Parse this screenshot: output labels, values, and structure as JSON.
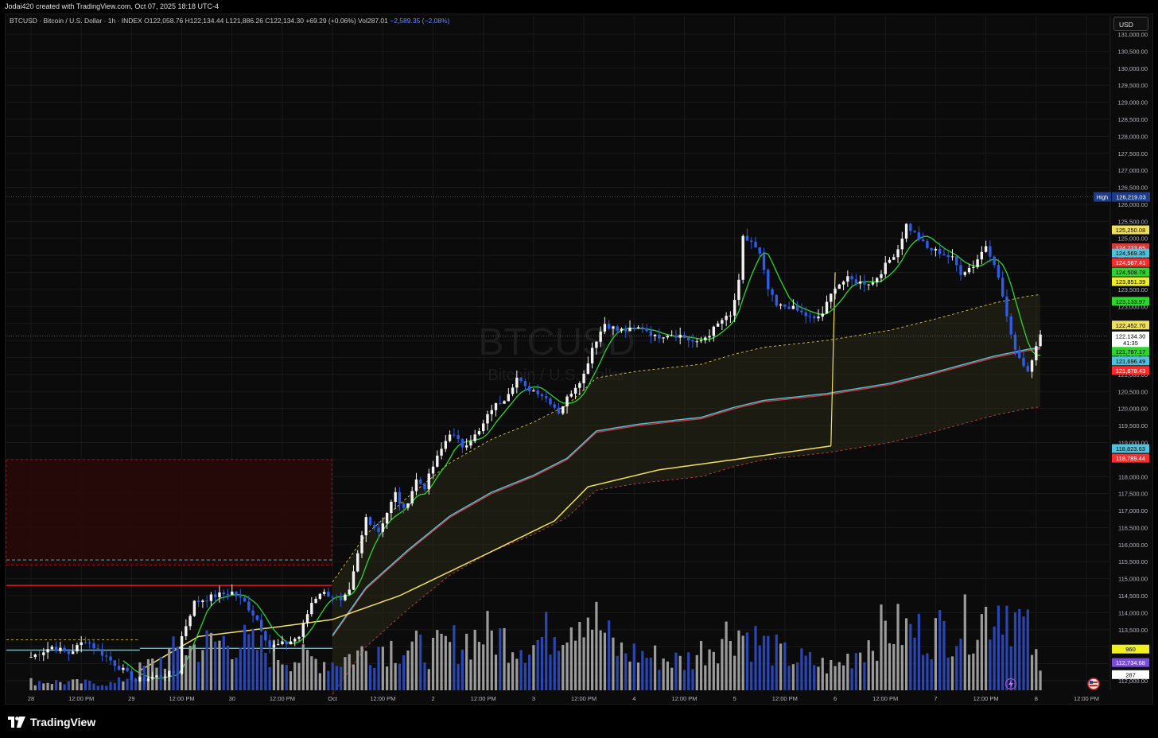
{
  "header": {
    "caption": "Jodai420 created with TradingView.com, Oct 07, 2025 18:18 UTC-4"
  },
  "legend": {
    "symbol": "BTCUSD · Bitcoin / U.S. Dollar · 1h · INDEX",
    "ohlc": "O122,058.76 H122,134.44 L121,886.26 C122,134.30 +69.29 (+0.06%)",
    "vol": "Vol287.01",
    "change": "−2,589.35 (−2.08%)"
  },
  "currency_label": "USD",
  "watermark": {
    "symbol": "BTCUSD",
    "name": "Bitcoin / U.S. Dollar"
  },
  "footer": {
    "brand": "TradingView"
  },
  "colors": {
    "background": "#0b0b0b",
    "grid": "#1a1a1a",
    "up_candle": "#f2f2f2",
    "down_candle": "#2f5ce6",
    "vwap_cyan": "#4fc3dd",
    "band_red": "#d23c3c",
    "band_yellow": "#f0e060",
    "green_line": "#2ed52e",
    "volume_up": "#9b9b9b",
    "volume_down": "#2a46b4"
  },
  "chart_data": {
    "type": "candlestick",
    "symbol": "BTCUSD",
    "timeframe": "1h",
    "y_ticks": [
      112000,
      112500,
      113000,
      113500,
      114000,
      114500,
      115000,
      115500,
      116000,
      116500,
      117000,
      117500,
      118000,
      118500,
      119000,
      119500,
      120000,
      120500,
      121000,
      121500,
      122000,
      122500,
      123000,
      123500,
      124000,
      124500,
      125000,
      125500,
      126000,
      126500,
      127000,
      127500,
      128000,
      128500,
      129000,
      129500,
      130000,
      130500,
      131000
    ],
    "y_tick_labels": [
      "112,000.00",
      "112,500.00",
      "113,000.00",
      "113,500.00",
      "114,000.00",
      "114,500.00",
      "115,000.00",
      "115,500.00",
      "116,000.00",
      "116,500.00",
      "117,000.00",
      "117,500.00",
      "118,000.00",
      "118,500.00",
      "119,000.00",
      "119,500.00",
      "120,000.00",
      "120,500.00",
      "121,000.00",
      "121,500.00",
      "122,000.00",
      "122,500.00",
      "123,000.00",
      "123,500.00",
      "124,000.00",
      "124,500.00",
      "125,000.00",
      "125,500.00",
      "126,000.00",
      "126,500.00",
      "127,000.00",
      "127,500.00",
      "128,000.00",
      "128,500.00",
      "129,000.00",
      "129,500.00",
      "130,000.00",
      "130,500.00",
      "131,000.00"
    ],
    "ylim": [
      111800,
      131300
    ],
    "x_ticks": [
      {
        "label": "28",
        "t": 0
      },
      {
        "label": "12:00 PM",
        "t": 12
      },
      {
        "label": "29",
        "t": 24
      },
      {
        "label": "12:00 PM",
        "t": 36
      },
      {
        "label": "30",
        "t": 48
      },
      {
        "label": "12:00 PM",
        "t": 60
      },
      {
        "label": "Oct",
        "t": 72
      },
      {
        "label": "12:00 PM",
        "t": 84
      },
      {
        "label": "2",
        "t": 96
      },
      {
        "label": "12:00 PM",
        "t": 108
      },
      {
        "label": "3",
        "t": 120
      },
      {
        "label": "12:00 PM",
        "t": 132
      },
      {
        "label": "4",
        "t": 144
      },
      {
        "label": "12:00 PM",
        "t": 156
      },
      {
        "label": "5",
        "t": 168
      },
      {
        "label": "12:00 PM",
        "t": 180
      },
      {
        "label": "6",
        "t": 192
      },
      {
        "label": "12:00 PM",
        "t": 204
      },
      {
        "label": "7",
        "t": 216
      },
      {
        "label": "12:00 PM",
        "t": 228
      },
      {
        "label": "8",
        "t": 240
      },
      {
        "label": "12:00 PM",
        "t": 252
      }
    ],
    "price_keypoints": [
      [
        0,
        112700
      ],
      [
        5,
        113000
      ],
      [
        9,
        112800
      ],
      [
        13,
        113200
      ],
      [
        19,
        112600
      ],
      [
        22,
        112300
      ],
      [
        25,
        112000
      ],
      [
        31,
        112150
      ],
      [
        35,
        112250
      ],
      [
        36,
        113300
      ],
      [
        39,
        114300
      ],
      [
        44,
        114500
      ],
      [
        48,
        114600
      ],
      [
        51,
        114300
      ],
      [
        54,
        113800
      ],
      [
        57,
        113000
      ],
      [
        61,
        113100
      ],
      [
        64,
        113300
      ],
      [
        67,
        114300
      ],
      [
        69,
        114600
      ],
      [
        72,
        114500
      ],
      [
        74,
        114300
      ],
      [
        76,
        114600
      ],
      [
        80,
        116800
      ],
      [
        83,
        116400
      ],
      [
        87,
        117500
      ],
      [
        89,
        117000
      ],
      [
        92,
        117900
      ],
      [
        94,
        117700
      ],
      [
        96,
        118300
      ],
      [
        100,
        119300
      ],
      [
        103,
        118900
      ],
      [
        107,
        119300
      ],
      [
        110,
        120000
      ],
      [
        113,
        120300
      ],
      [
        116,
        120900
      ],
      [
        118,
        120600
      ],
      [
        121,
        120500
      ],
      [
        124,
        120200
      ],
      [
        126,
        119900
      ],
      [
        129,
        120500
      ],
      [
        132,
        121000
      ],
      [
        134,
        121800
      ],
      [
        137,
        122500
      ],
      [
        140,
        122300
      ],
      [
        143,
        122300
      ],
      [
        146,
        122400
      ],
      [
        149,
        122100
      ],
      [
        152,
        122200
      ],
      [
        155,
        122150
      ],
      [
        159,
        121900
      ],
      [
        162,
        122200
      ],
      [
        165,
        122600
      ],
      [
        167,
        122700
      ],
      [
        169,
        123700
      ],
      [
        170,
        125000
      ],
      [
        172,
        124900
      ],
      [
        174,
        124500
      ],
      [
        176,
        123500
      ],
      [
        178,
        123000
      ],
      [
        181,
        123000
      ],
      [
        184,
        122800
      ],
      [
        187,
        122600
      ],
      [
        189,
        122800
      ],
      [
        192,
        123600
      ],
      [
        195,
        123800
      ],
      [
        198,
        123700
      ],
      [
        201,
        123700
      ],
      [
        204,
        124200
      ],
      [
        207,
        124700
      ],
      [
        209,
        125400
      ],
      [
        212,
        125000
      ],
      [
        214,
        124700
      ],
      [
        217,
        124600
      ],
      [
        220,
        124400
      ],
      [
        222,
        124000
      ],
      [
        225,
        124200
      ],
      [
        228,
        124800
      ],
      [
        230,
        124300
      ],
      [
        232,
        123300
      ],
      [
        234,
        122100
      ],
      [
        236,
        121500
      ],
      [
        238,
        121100
      ],
      [
        239,
        121500
      ],
      [
        240,
        121900
      ],
      [
        241,
        122134
      ]
    ],
    "volume_keypoints": [
      [
        0,
        0.08
      ],
      [
        20,
        0.06
      ],
      [
        35,
        0.35
      ],
      [
        48,
        0.45
      ],
      [
        60,
        0.3
      ],
      [
        72,
        0.25
      ],
      [
        84,
        0.4
      ],
      [
        96,
        0.35
      ],
      [
        108,
        0.5
      ],
      [
        120,
        0.4
      ],
      [
        132,
        0.75
      ],
      [
        140,
        0.35
      ],
      [
        156,
        0.25
      ],
      [
        168,
        0.55
      ],
      [
        180,
        0.3
      ],
      [
        192,
        0.2
      ],
      [
        204,
        0.55
      ],
      [
        214,
        0.5
      ],
      [
        226,
        0.6
      ],
      [
        232,
        0.8
      ],
      [
        238,
        0.5
      ],
      [
        241,
        0.15
      ]
    ],
    "levels": {
      "high_marker": {
        "label": "High",
        "value": "126,219.03",
        "price": 126219.03
      },
      "right_labels": [
        {
          "value": "125,250.08",
          "price": 125250,
          "color": "#f0e060",
          "text_color": "#000"
        },
        {
          "value": "124,723.65",
          "price": 124724,
          "color": "#d23c3c",
          "text_color": "#fff"
        },
        {
          "value": "124,569.35",
          "price": 124569,
          "color": "#4fc3dd",
          "text_color": "#000"
        },
        {
          "value": "124,567.41",
          "price": 124290,
          "color": "#ff2a2a",
          "text_color": "#fff"
        },
        {
          "value": "124,508.78",
          "price": 124010,
          "color": "#2ed52e",
          "text_color": "#000"
        },
        {
          "value": "123,851.39",
          "price": 123730,
          "color": "#f0f020",
          "text_color": "#000"
        },
        {
          "value": "123,133.97",
          "price": 123150,
          "color": "#2ed52e",
          "text_color": "#000"
        },
        {
          "value": "122,452.70",
          "price": 122452,
          "color": "#f0e060",
          "text_color": "#000"
        },
        {
          "value": "122,134.30",
          "price": 122134,
          "color": "#ffffff",
          "text_color": "#000"
        },
        {
          "value": "41:35",
          "price": 121930,
          "color": "#ffffff",
          "text_color": "#000"
        },
        {
          "value": "121,767.17",
          "price": 121680,
          "color": "#2ed52e",
          "text_color": "#000"
        },
        {
          "value": "121,696.49",
          "price": 121400,
          "color": "#4fc3dd",
          "text_color": "#000"
        },
        {
          "value": "121,678.43",
          "price": 121120,
          "color": "#ff2a2a",
          "text_color": "#fff"
        },
        {
          "value": "118,823.63",
          "price": 118823,
          "color": "#4fc3dd",
          "text_color": "#000"
        },
        {
          "value": "118,789.44",
          "price": 118540,
          "color": "#ff2a2a",
          "text_color": "#fff"
        },
        {
          "value": "960",
          "price": 112930,
          "color": "#f0f020",
          "text_color": "#000"
        },
        {
          "value": "112,734.68",
          "price": 112534,
          "color": "#7a4fd6",
          "text_color": "#fff"
        },
        {
          "value": "287",
          "price": 112180,
          "color": "#ffffff",
          "text_color": "#000"
        }
      ]
    }
  }
}
